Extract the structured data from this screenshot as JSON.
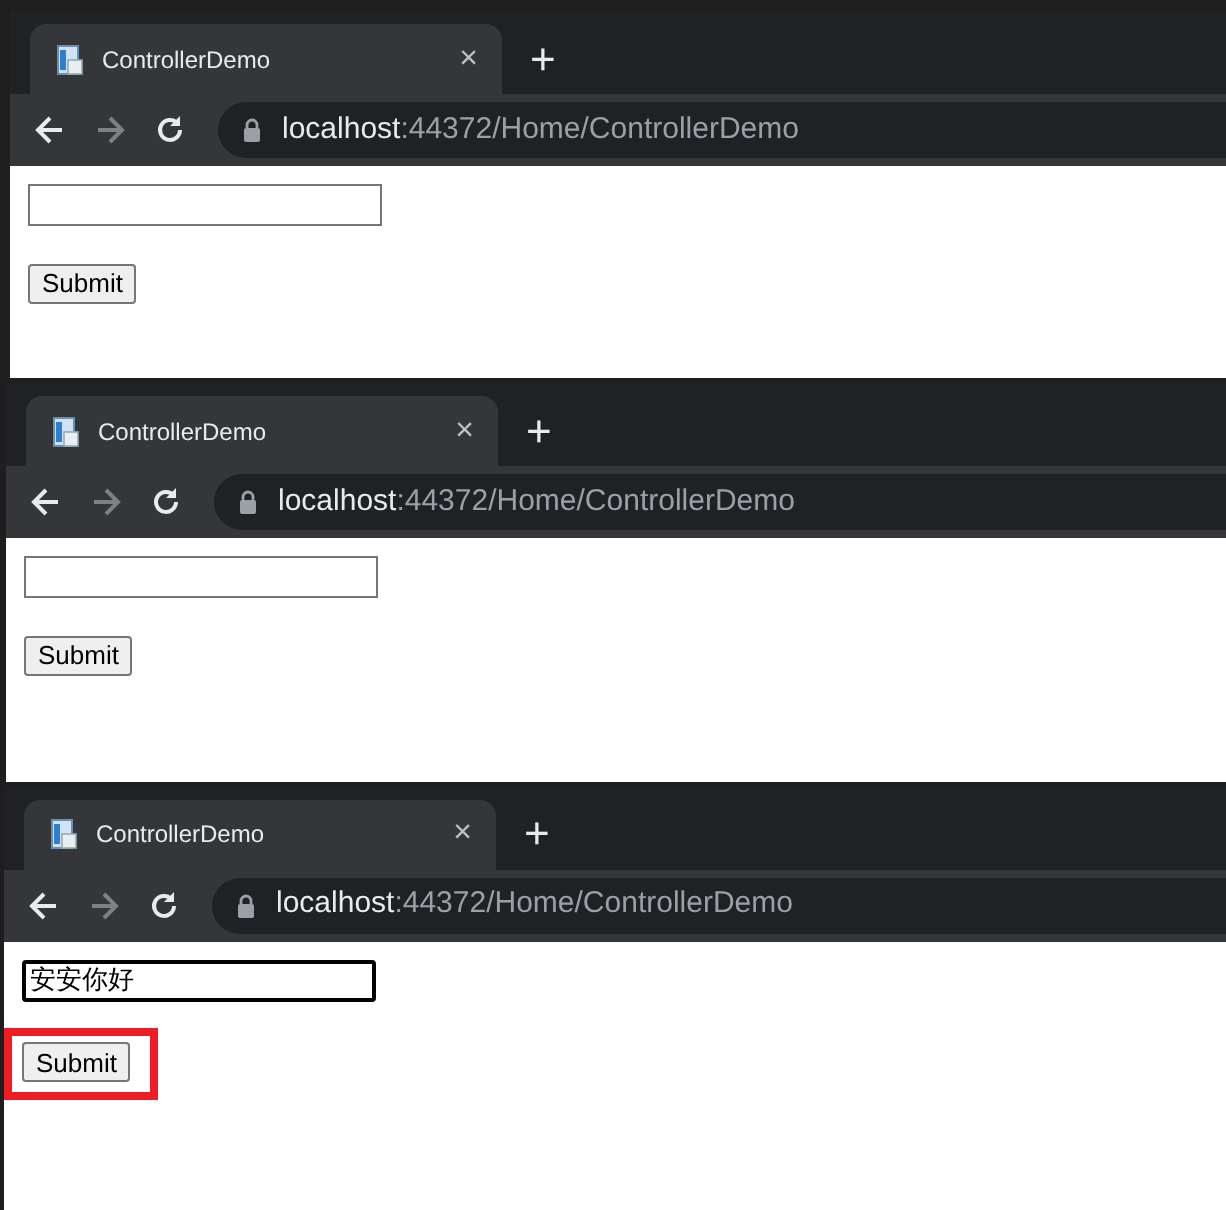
{
  "windows": [
    {
      "tab": {
        "title": "ControllerDemo",
        "close": "×"
      },
      "new_tab": "+",
      "address": {
        "host": "localhost",
        "path": ":44372/Home/ControllerDemo"
      },
      "field": {
        "focused": false
      },
      "submit": {
        "label": "Submit",
        "highlighted": false
      }
    },
    {
      "tab": {
        "title": "ControllerDemo",
        "close": "×"
      },
      "new_tab": "+",
      "address": {
        "host": "localhost",
        "path": ":44372/Home/ControllerDemo"
      },
      "field": {
        "focused": false
      },
      "submit": {
        "label": "Submit",
        "highlighted": false
      }
    },
    {
      "tab": {
        "title": "ControllerDemo",
        "close": "×"
      },
      "new_tab": "+",
      "address": {
        "host": "localhost",
        "path": ":44372/Home/ControllerDemo"
      },
      "field": {
        "value": "安安你好",
        "focused": true
      },
      "submit": {
        "label": "Submit",
        "highlighted": true
      }
    }
  ]
}
